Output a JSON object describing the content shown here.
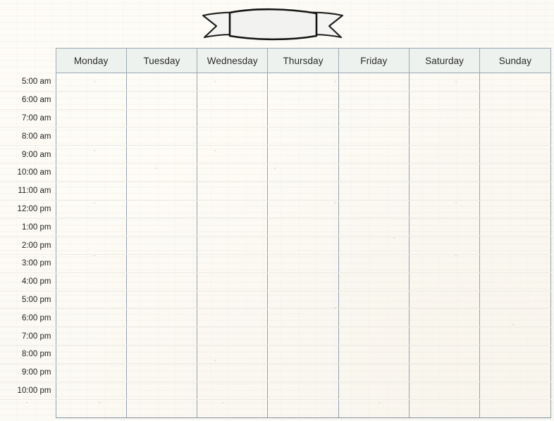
{
  "page": {
    "title": "Weekly Schedule Planner",
    "background_color": "#fcfaf4",
    "paper_texture": "lined-cream-paper"
  },
  "banner": {
    "name": "ribbon-banner",
    "text": "",
    "fill_color": "#f2f2f0",
    "stroke_color": "#1c1c1c",
    "style": "hand-drawn-swallowtail-ribbon"
  },
  "schedule": {
    "time_column_header": "",
    "days": [
      {
        "label": "Monday"
      },
      {
        "label": "Tuesday"
      },
      {
        "label": "Wednesday"
      },
      {
        "label": "Thursday"
      },
      {
        "label": "Friday"
      },
      {
        "label": "Saturday"
      },
      {
        "label": "Sunday"
      }
    ],
    "times": [
      {
        "label": "5:00 am"
      },
      {
        "label": "6:00 am"
      },
      {
        "label": "7:00 am"
      },
      {
        "label": "8:00 am"
      },
      {
        "label": "9:00 am"
      },
      {
        "label": "10:00 am"
      },
      {
        "label": "11:00 am"
      },
      {
        "label": "12:00 pm"
      },
      {
        "label": "1:00 pm"
      },
      {
        "label": "2:00 pm"
      },
      {
        "label": "3:00 pm"
      },
      {
        "label": "4:00 pm"
      },
      {
        "label": "5:00 pm"
      },
      {
        "label": "6:00 pm"
      },
      {
        "label": "7:00 pm"
      },
      {
        "label": "8:00 pm"
      },
      {
        "label": "9:00 pm"
      },
      {
        "label": "10:00 pm"
      },
      {
        "label": ""
      }
    ],
    "entries": [],
    "colors": {
      "header_background": "#eef2ee",
      "header_border": "#9aaab6",
      "column_divider": "#8fa3b5",
      "row_divider": "#eceae3",
      "header_text": "#2a2a2a",
      "time_text": "#1f1f1f"
    }
  }
}
